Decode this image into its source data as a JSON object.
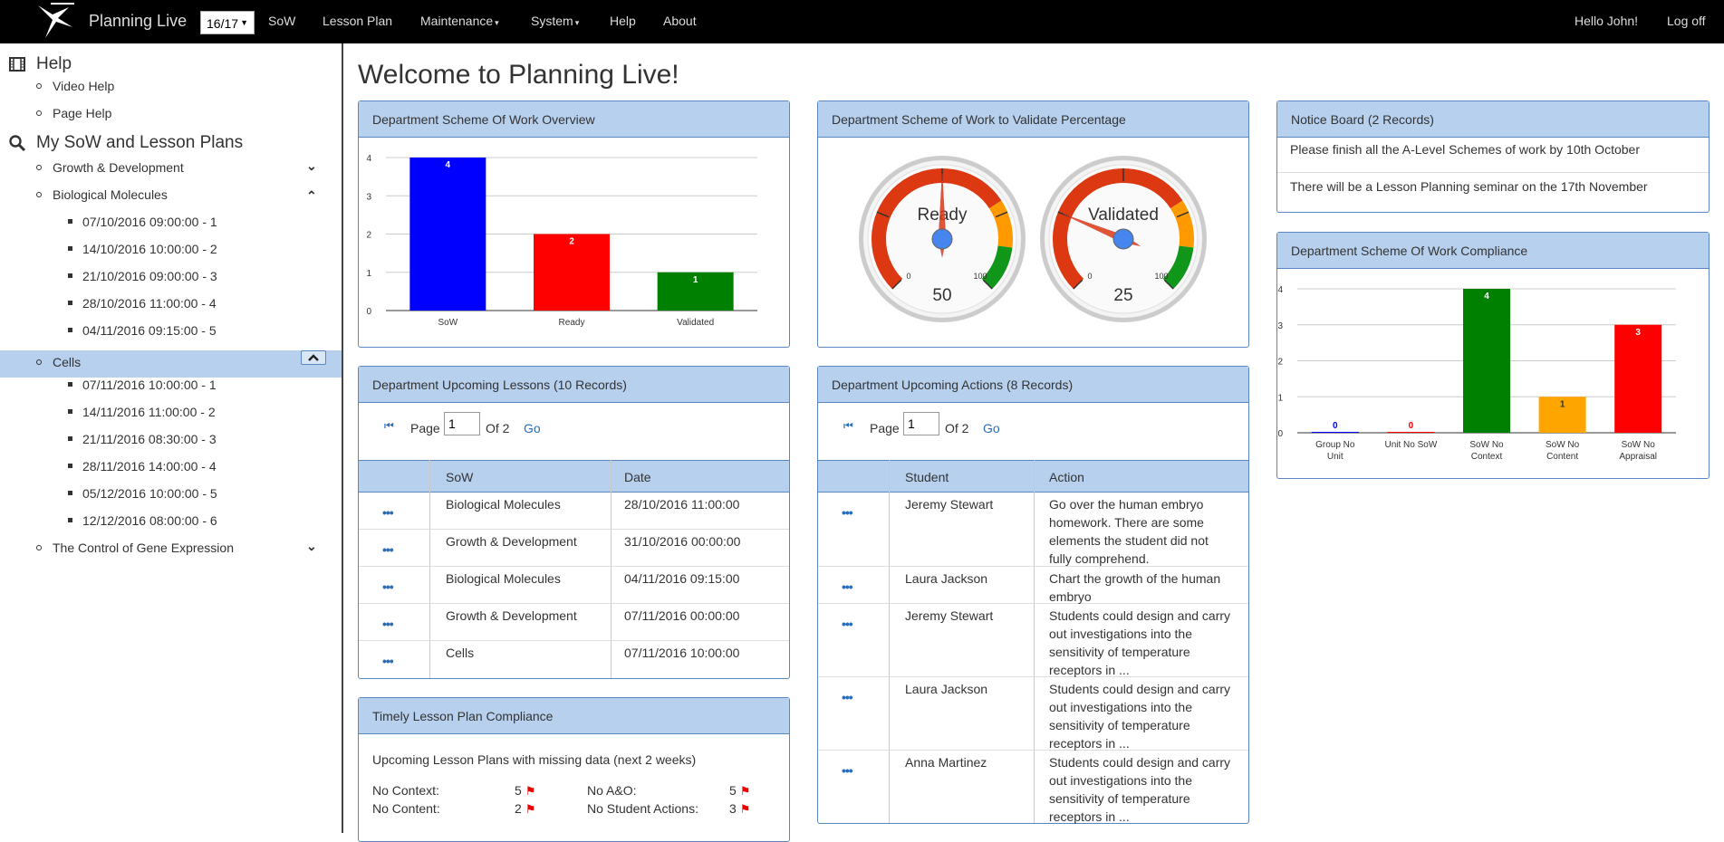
{
  "navbar": {
    "brand": "Planning Live",
    "year": "16/17",
    "menu": [
      "SoW",
      "Lesson Plan",
      "Maintenance",
      "System",
      "Help",
      "About"
    ],
    "greeting": "Hello John!",
    "logoff": "Log off"
  },
  "sidebar": {
    "help_title": "Help",
    "help_items": [
      "Video Help",
      "Page Help"
    ],
    "sow_title": "My SoW and Lesson Plans",
    "groups": [
      {
        "label": "Growth & Development",
        "items": []
      },
      {
        "label": "Biological Molecules",
        "items": [
          "07/10/2016 09:00:00 - 1",
          "14/10/2016 10:00:00 - 2",
          "21/10/2016 09:00:00 - 3",
          "28/10/2016 11:00:00 - 4",
          "04/11/2016 09:15:00 - 5"
        ]
      },
      {
        "label": "Cells",
        "items": [
          "07/11/2016 10:00:00 - 1",
          "14/11/2016 11:00:00 - 2",
          "21/11/2016 08:30:00 - 3",
          "28/11/2016 14:00:00 - 4",
          "05/12/2016 10:00:00 - 5",
          "12/12/2016 08:00:00 - 6"
        ]
      },
      {
        "label": "The Control of Gene Expression",
        "items": []
      }
    ]
  },
  "welcome": "Welcome to Planning Live!",
  "panels": {
    "overview_title": "Department Scheme Of Work Overview",
    "validate_title": "Department Scheme of Work to Validate Percentage",
    "notice_title": "Notice Board (2 Records)",
    "compliance_title": "Department Scheme Of Work Compliance",
    "lessons_title": "Department Upcoming Lessons (10 Records)",
    "actions_title": "Department Upcoming Actions (8 Records)",
    "timely_title": "Timely Lesson Plan Compliance"
  },
  "notices": [
    "Please finish all the A-Level Schemes of work by 10th October",
    "There will be a Lesson Planning seminar on the 17th November"
  ],
  "gauges": [
    {
      "label": "Ready",
      "value": 50,
      "min": "0",
      "max": "100"
    },
    {
      "label": "Validated",
      "value": 25,
      "min": "0",
      "max": "100"
    }
  ],
  "lessons": {
    "pager": {
      "page_label": "Page",
      "page": "1",
      "of_label": "Of 2",
      "go": "Go"
    },
    "headers": [
      "SoW",
      "Date"
    ],
    "rows": [
      [
        "Biological Molecules",
        "28/10/2016 11:00:00"
      ],
      [
        "Growth & Development",
        "31/10/2016 00:00:00"
      ],
      [
        "Biological Molecules",
        "04/11/2016 09:15:00"
      ],
      [
        "Growth & Development",
        "07/11/2016 00:00:00"
      ],
      [
        "Cells",
        "07/11/2016 10:00:00"
      ]
    ]
  },
  "actions": {
    "pager": {
      "page_label": "Page",
      "page": "1",
      "of_label": "Of 2",
      "go": "Go"
    },
    "headers": [
      "Student",
      "Action"
    ],
    "rows": [
      [
        "Jeremy Stewart",
        [
          "Go over the human embryo",
          "homework. There are some",
          "elements the student did not",
          "fully comprehend."
        ]
      ],
      [
        "Laura Jackson",
        [
          "Chart the growth of the human",
          "embryo"
        ]
      ],
      [
        "Jeremy Stewart",
        [
          "Students could design and carry",
          "out investigations into the",
          "sensitivity of temperature",
          "receptors in ..."
        ]
      ],
      [
        "Laura Jackson",
        [
          "Students could design and carry",
          "out investigations into the",
          "sensitivity of temperature",
          "receptors in ..."
        ]
      ],
      [
        "Anna Martinez",
        [
          "Students could design and carry",
          "out investigations into the",
          "sensitivity of temperature",
          "receptors in ..."
        ]
      ]
    ]
  },
  "timely": {
    "subtitle": "Upcoming Lesson Plans with missing data (next 2 weeks)",
    "items": [
      {
        "label": "No Context:",
        "value": "5"
      },
      {
        "label": "No A&O:",
        "value": "5"
      },
      {
        "label": "No Content:",
        "value": "2"
      },
      {
        "label": "No Student Actions:",
        "value": "3"
      }
    ]
  },
  "chart_data": [
    {
      "type": "bar",
      "categories": [
        "SoW",
        "Ready",
        "Validated"
      ],
      "values": [
        4,
        2,
        1
      ],
      "colors": [
        "#0000ff",
        "#ff0000",
        "#008000"
      ],
      "ylim": [
        0,
        4
      ],
      "yticks": [
        "0",
        "1",
        "2",
        "3",
        "4"
      ],
      "title": "",
      "xlabel": "",
      "ylabel": ""
    },
    {
      "type": "bar",
      "categories": [
        [
          "Group No",
          "Unit"
        ],
        [
          "Unit No SoW"
        ],
        [
          "SoW No",
          "Context"
        ],
        [
          "SoW No",
          "Content"
        ],
        [
          "SoW No",
          "Appraisal"
        ]
      ],
      "values": [
        0,
        0,
        4,
        1,
        3
      ],
      "colors": [
        "#0000ff",
        "#ff0000",
        "#008000",
        "#ffa500",
        "#ff0000"
      ],
      "ylim": [
        0,
        4
      ],
      "yticks": [
        "0",
        "1",
        "2",
        "3",
        "4"
      ],
      "title": "",
      "xlabel": "",
      "ylabel": ""
    }
  ]
}
